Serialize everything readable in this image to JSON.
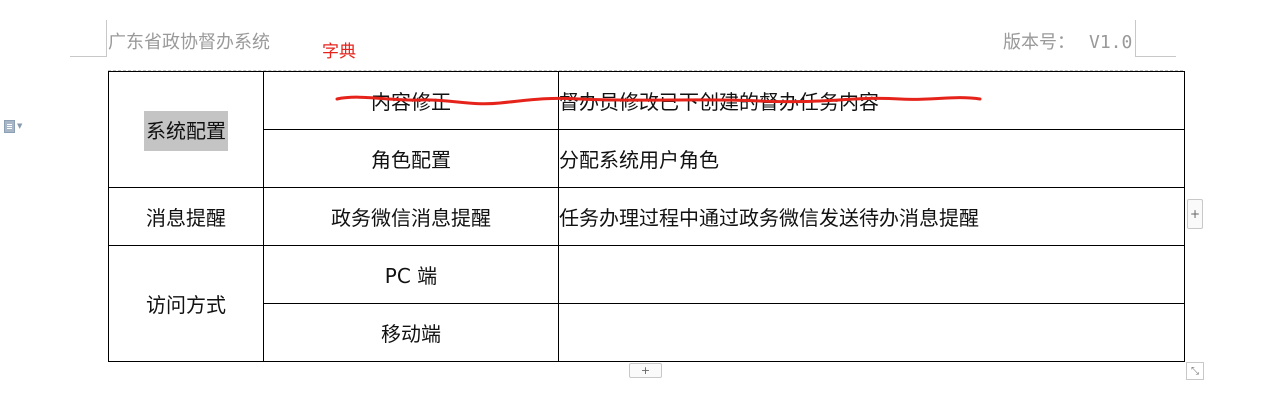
{
  "header": {
    "title": "广东省政协督办系统",
    "annotation": "字典",
    "version_label": "版本号：",
    "version_value": "V1.0"
  },
  "table": {
    "rows": [
      {
        "group": "系统配置",
        "item": "内容修正",
        "desc": "督办员修改已下创建的督办任务内容",
        "struck": true
      },
      {
        "group": "",
        "item": "角色配置",
        "desc": "分配系统用户角色"
      },
      {
        "group": "消息提醒",
        "item": "政务微信消息提醒",
        "desc": "任务办理过程中通过政务微信发送待办消息提醒"
      },
      {
        "group": "访问方式",
        "item": "PC 端",
        "desc": ""
      },
      {
        "group": "",
        "item": "移动端",
        "desc": ""
      }
    ]
  },
  "controls": {
    "add_symbol": "+",
    "resize_symbol": "⤡",
    "icon_name": "document-icon"
  },
  "colors": {
    "annotation": "#e5231b",
    "strike": "#e5231b",
    "highlight": "#c4c4c4",
    "header_text": "#9a9a9a"
  }
}
